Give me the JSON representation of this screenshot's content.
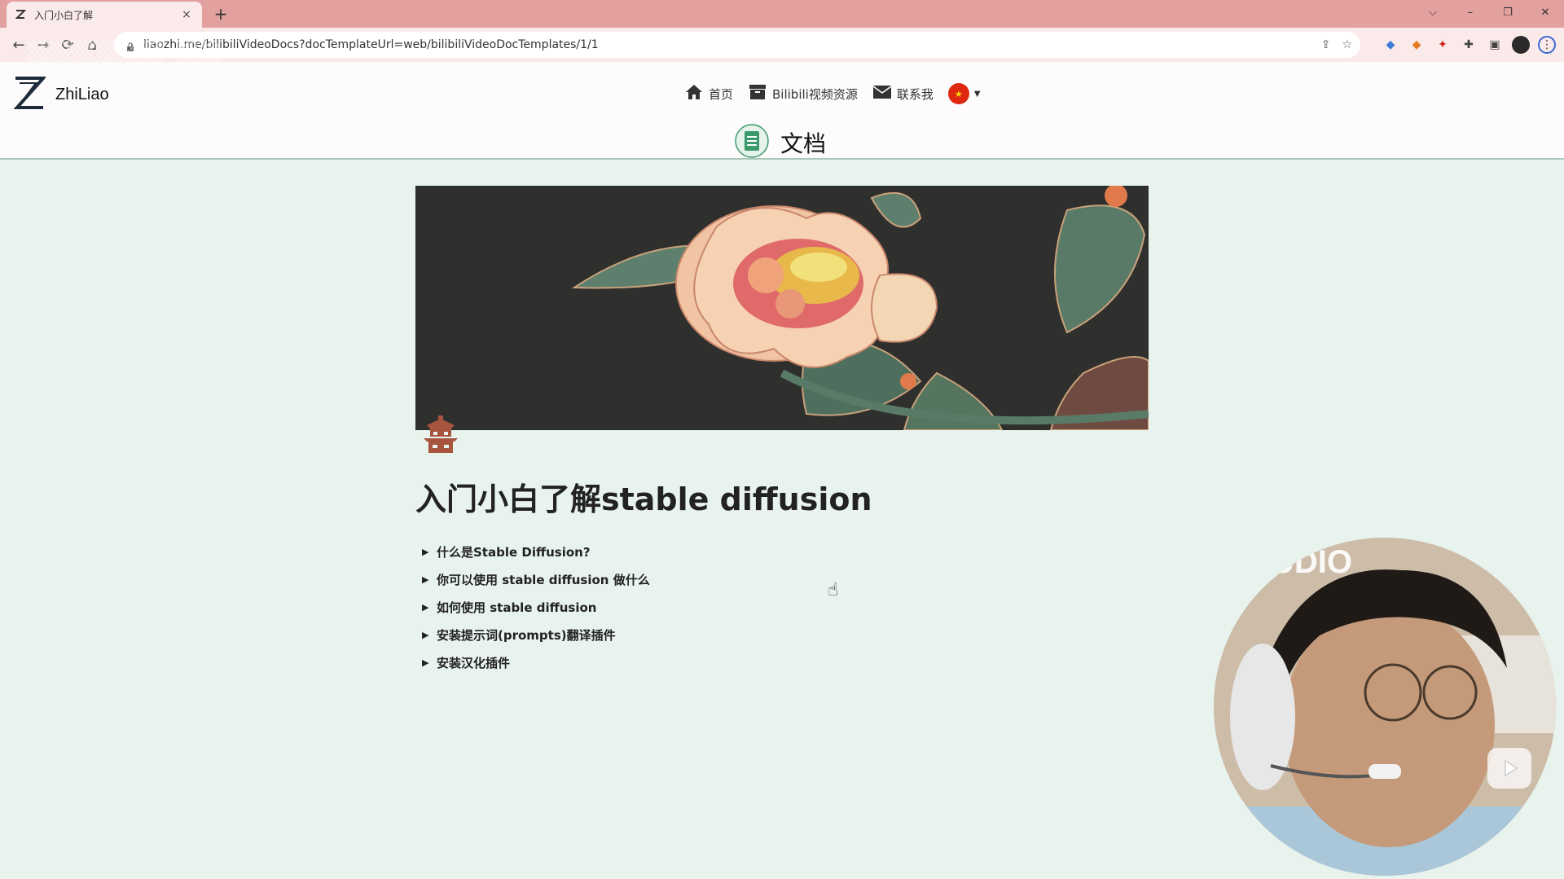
{
  "browser": {
    "tab_title": "入门小白了解",
    "tab_close": "×",
    "new_tab": "+",
    "url": "liaozhi.me/bilibiliVideoDocs?docTemplateUrl=web/bilibiliVideoDocTemplates/1/1",
    "window_controls": [
      "⌵",
      "–",
      "❐",
      "✕"
    ],
    "nav": {
      "back": "←",
      "forward": "→",
      "reload": "⟳",
      "home": "⌂"
    }
  },
  "site": {
    "brand_name": "ZhiLiao",
    "nav_items": [
      {
        "label": "首页",
        "icon": "home-icon"
      },
      {
        "label": "Bilibili视频资源",
        "icon": "archive-icon"
      },
      {
        "label": "联系我",
        "icon": "mail-icon"
      }
    ],
    "language_flag": "china-flag-icon",
    "section_title": "文档"
  },
  "document": {
    "title": "入门小白了解stable diffusion",
    "toggles": [
      "什么是Stable Diffusion?",
      "你可以使用 stable diffusion 做什么",
      "如何使用 stable diffusion",
      "安装提示词(prompts)翻译插件",
      "安装汉化插件"
    ]
  },
  "overlay": {
    "webcam_text": "UDIO"
  },
  "colors": {
    "tabbar": "#e2a09f",
    "toolbar": "#fbeaea",
    "page_bg": "#e8f3ee",
    "header_border": "#a8c8b8",
    "accent_green": "#3c9a6a"
  }
}
